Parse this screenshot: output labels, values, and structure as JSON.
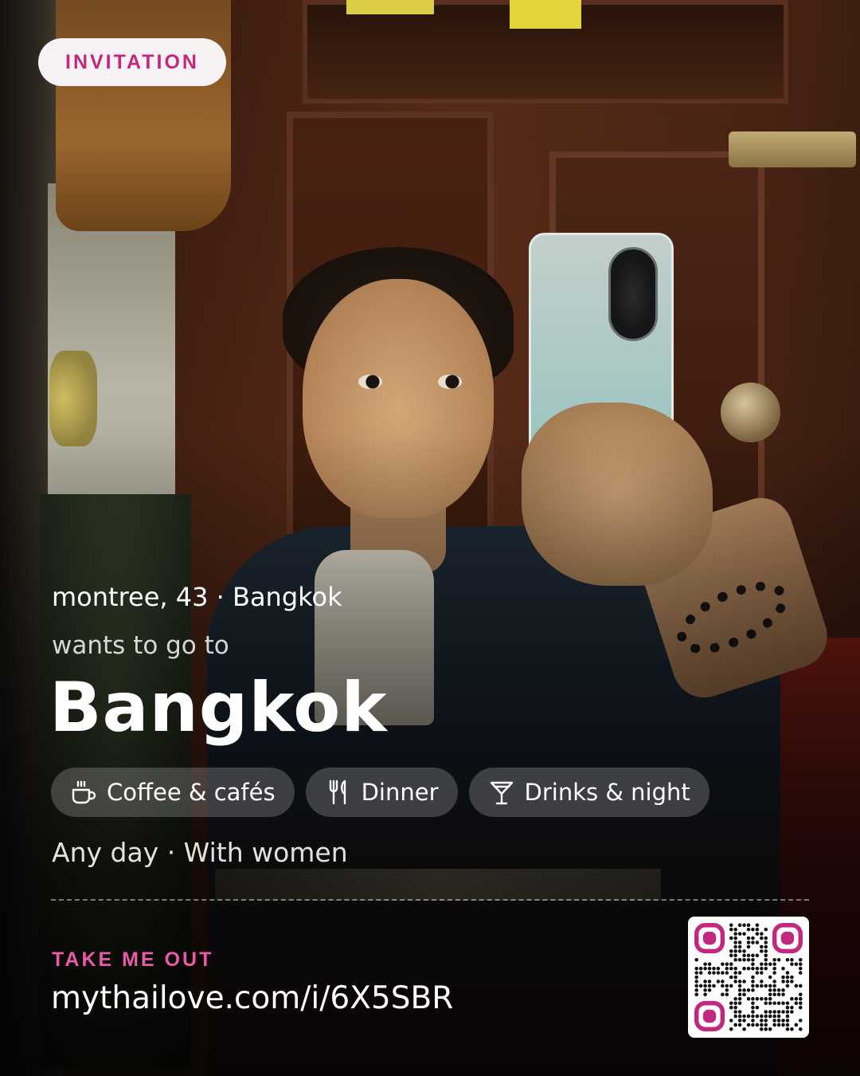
{
  "badge": {
    "label": "INVITATION"
  },
  "profile": {
    "summary": "montree, 43 · Bangkok",
    "intent": "wants to go to",
    "destination": "Bangkok"
  },
  "activities": [
    {
      "label": "Coffee & cafés",
      "icon": "coffee-cup-icon"
    },
    {
      "label": "Dinner",
      "icon": "fork-knife-icon"
    },
    {
      "label": "Drinks & night",
      "icon": "cocktail-glass-icon"
    }
  ],
  "availability": "Any day · With women",
  "cta": {
    "label": "TAKE ME OUT",
    "url": "mythailove.com/i/6X5SBR"
  },
  "colors": {
    "accent": "#c2287e",
    "accent_light": "#ea5aa8",
    "badge_bg": "#f7f3f5"
  }
}
